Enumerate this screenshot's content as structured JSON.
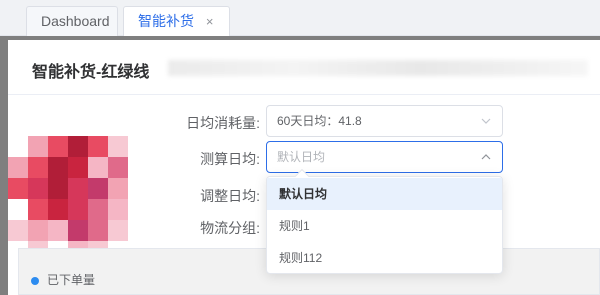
{
  "tabs": [
    {
      "label": "Dashboard"
    },
    {
      "label": "智能补货",
      "close": "×"
    }
  ],
  "dialog": {
    "title": "智能补货-红绿线"
  },
  "form": {
    "daily_consumption": {
      "label": "日均消耗量:",
      "value": "60天日均：41.8"
    },
    "calc_daily": {
      "label": "测算日均:",
      "placeholder": "默认日均"
    },
    "adjust_daily": {
      "label": "调整日均:"
    },
    "logistics_group": {
      "label": "物流分组:"
    }
  },
  "dropdown": {
    "options": [
      "默认日均",
      "规则1",
      "规则112"
    ],
    "selected": "默认日均"
  },
  "list": {
    "item1": "已下单量"
  },
  "colors": {
    "accent": "#2d6ee8",
    "selected_bg": "#e8f1fd"
  }
}
